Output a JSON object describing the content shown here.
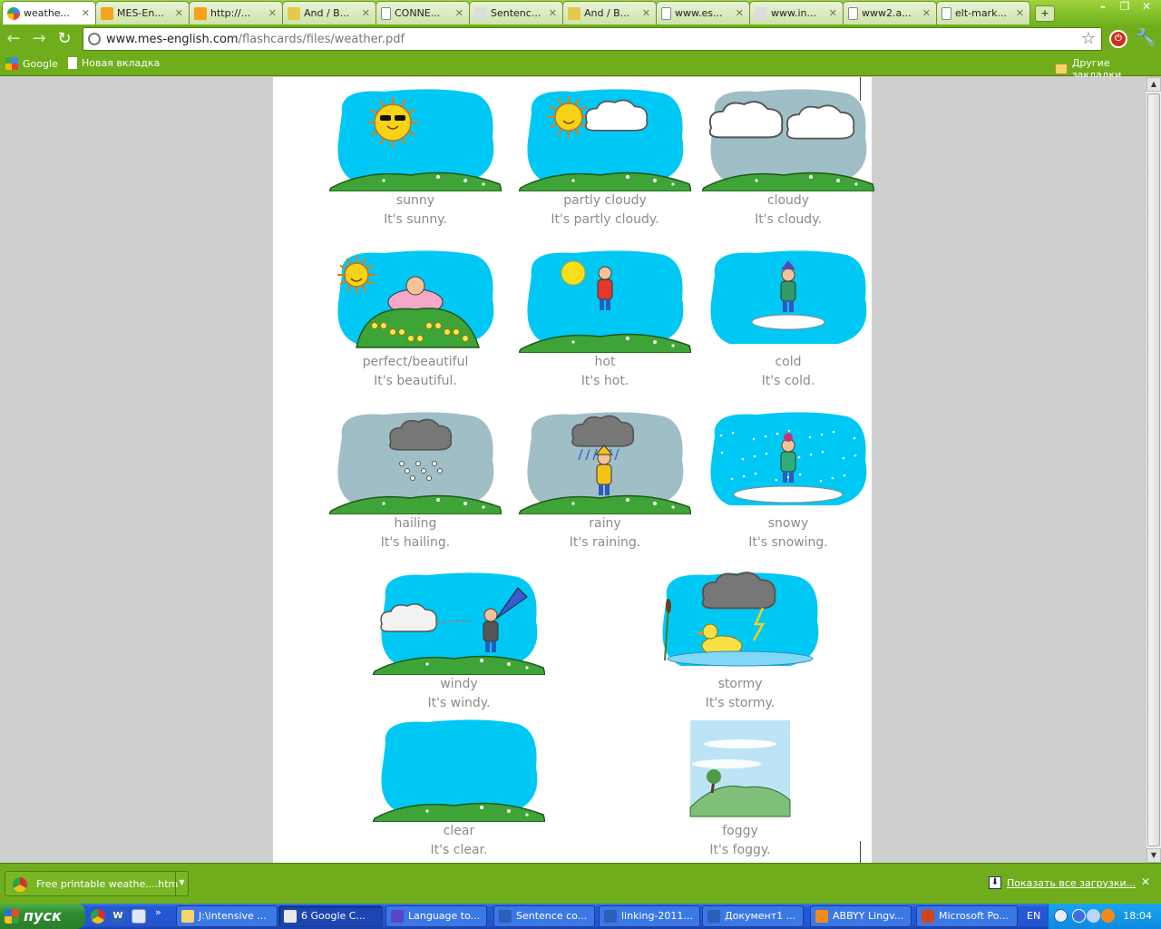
{
  "browser": {
    "tabs": [
      {
        "title": "weathe...",
        "favicon": "google-icon",
        "active": true
      },
      {
        "title": "MES-En...",
        "favicon": "mes-icon",
        "active": false
      },
      {
        "title": "http://...",
        "favicon": "mes-icon",
        "active": false
      },
      {
        "title": "And / B...",
        "favicon": "b-icon",
        "active": false
      },
      {
        "title": "CONNE...",
        "favicon": "page-icon",
        "active": false
      },
      {
        "title": "Sentenc...",
        "favicon": "tool-icon",
        "active": false
      },
      {
        "title": "And / B...",
        "favicon": "b-icon",
        "active": false
      },
      {
        "title": "www.es...",
        "favicon": "page-icon",
        "active": false
      },
      {
        "title": "www.in...",
        "favicon": "tool-icon",
        "active": false
      },
      {
        "title": "www2.a...",
        "favicon": "page-icon",
        "active": false
      },
      {
        "title": "elt-mark...",
        "favicon": "page-icon",
        "active": false
      }
    ],
    "new_tab_label": "+",
    "url_host": "www.mes-english.com",
    "url_path": "/flashcards/files/weather.pdf",
    "bookmarks": [
      "Google",
      "Новая вкладка"
    ],
    "other_bookmarks": "Другие закладки"
  },
  "cards": [
    {
      "scene": "sunny",
      "label": "sunny",
      "sentence": "It's sunny."
    },
    {
      "scene": "partly-cloudy",
      "label": "partly cloudy",
      "sentence": "It's partly cloudy."
    },
    {
      "scene": "cloudy",
      "label": "cloudy",
      "sentence": "It's cloudy."
    },
    {
      "scene": "beautiful",
      "label": "perfect/beautiful",
      "sentence": "It's beautiful."
    },
    {
      "scene": "hot",
      "label": "hot",
      "sentence": "It's hot."
    },
    {
      "scene": "cold",
      "label": "cold",
      "sentence": "It's cold."
    },
    {
      "scene": "hailing",
      "label": "hailing",
      "sentence": "It's hailing."
    },
    {
      "scene": "rainy",
      "label": "rainy",
      "sentence": "It's raining."
    },
    {
      "scene": "snowy",
      "label": "snowy",
      "sentence": "It's snowing."
    },
    {
      "scene": "windy",
      "label": "windy",
      "sentence": "It's windy."
    },
    {
      "scene": "stormy",
      "label": "stormy",
      "sentence": "It's stormy."
    },
    {
      "scene": "clear",
      "label": "clear",
      "sentence": "It's clear."
    },
    {
      "scene": "foggy",
      "label": "foggy",
      "sentence": "It's foggy."
    }
  ],
  "colors": {
    "sky": "#00c8f5",
    "grey_sky": "#9fbec6",
    "grass": "#3fa437",
    "sun": "#f7d316",
    "chrome_green": "#6fad1c"
  },
  "downloads": {
    "item": "Free printable weathe....htm",
    "show_all": "Показать все загрузки..."
  },
  "taskbar": {
    "start": "пуск",
    "tasks": [
      {
        "label": "J:\\intensive ...",
        "active": false
      },
      {
        "label": "6 Google C...",
        "active": true
      },
      {
        "label": "Language to...",
        "active": false
      },
      {
        "label": "Sentence co...",
        "active": false
      },
      {
        "label": "linking-2011...",
        "active": false
      },
      {
        "label": "Документ1 ...",
        "active": false
      },
      {
        "label": "ABBYY Lingv...",
        "active": false
      },
      {
        "label": "Microsoft Po...",
        "active": false
      }
    ],
    "lang": "EN",
    "clock": "18:04"
  }
}
